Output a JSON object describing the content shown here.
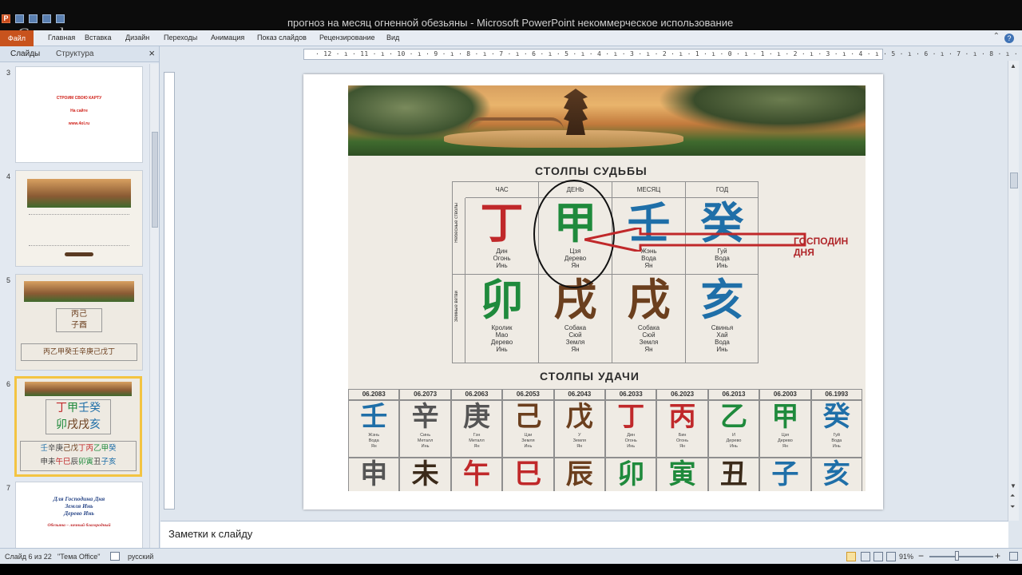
{
  "window": {
    "title": "прогноз на месяц огненной обезьяны - Microsoft PowerPoint некоммерческое использование",
    "watermark": "Google"
  },
  "ribbon": {
    "file": "Файл",
    "tabs": [
      "Главная",
      "Вставка",
      "Дизайн",
      "Переходы",
      "Анимация",
      "Показ слайдов",
      "Рецензирование",
      "Вид"
    ]
  },
  "left_panel": {
    "tab_slides": "Слайды",
    "tab_outline": "Структура",
    "close": "×",
    "slides": [
      {
        "num": "3",
        "lines": [
          "СТРОИМ СВОЮ КАРТУ",
          "На сайте",
          "www.4ol.ru"
        ]
      },
      {
        "num": "4"
      },
      {
        "num": "5"
      },
      {
        "num": "6"
      },
      {
        "num": "7",
        "lines": [
          "Для Господина Дня",
          "Земля Инь",
          "Дерево Инь",
          "Обезьяна – личный благородный"
        ]
      }
    ]
  },
  "ruler": {
    "labels": "· 12 · ı · 11 · ı · 10 · ı · 9 · ı · 8 · ı · 7 · ı · 6 · ı · 5 · ı · 4 · ı · 3 · ı · 2 · ı · 1 · ı · 0 · ı · 1 · ı · 2 · ı · 3 · ı · 4 · ı · 5 · ı · 6 · ı · 7 · ı · 8 · ı · 9 · ı · 10 · ı · 11 · ı · 12 ·"
  },
  "slide": {
    "fate_title": "СТОЛПЫ СУДЬБЫ",
    "side_top": "Небесные стволы",
    "side_bottom": "Земные ветви",
    "columns": [
      "ЧАС",
      "ДЕНЬ",
      "МЕСЯЦ",
      "ГОД"
    ],
    "stems": [
      {
        "glyph": "丁",
        "color": "#c0282a",
        "lines": [
          "Дин",
          "Огонь",
          "Инь"
        ]
      },
      {
        "glyph": "甲",
        "color": "#1f8a3c",
        "lines": [
          "Цзя",
          "Дерево",
          "Ян"
        ]
      },
      {
        "glyph": "壬",
        "color": "#1f6fa8",
        "lines": [
          "Жэнь",
          "Вода",
          "Ян"
        ]
      },
      {
        "glyph": "癸",
        "color": "#1f6fa8",
        "lines": [
          "Гуй",
          "Вода",
          "Инь"
        ]
      }
    ],
    "branches": [
      {
        "glyph": "卯",
        "color": "#1f8a3c",
        "lines": [
          "Кролик",
          "Мао",
          "Дерево",
          "Инь"
        ]
      },
      {
        "glyph": "戌",
        "color": "#6b3f1e",
        "lines": [
          "Собака",
          "Сюй",
          "Земля",
          "Ян"
        ]
      },
      {
        "glyph": "戌",
        "color": "#6b3f1e",
        "lines": [
          "Собака",
          "Сюй",
          "Земля",
          "Ян"
        ]
      },
      {
        "glyph": "亥",
        "color": "#1f6fa8",
        "lines": [
          "Свинья",
          "Хай",
          "Вода",
          "Инь"
        ]
      }
    ],
    "lord_label": [
      "ГОСПОДИН",
      "ДНЯ"
    ],
    "luck_title": "СТОЛПЫ УДАЧИ",
    "luck": [
      {
        "date": "06.2083",
        "stem": "壬",
        "stem_color": "#1f6fa8",
        "lines": [
          "Жэнь",
          "Вода",
          "Ян"
        ],
        "branch": "申",
        "branch_color": "#555555"
      },
      {
        "date": "06.2073",
        "stem": "辛",
        "stem_color": "#555555",
        "lines": [
          "Синь",
          "Металл",
          "Инь"
        ],
        "branch": "未",
        "branch_color": "#3b2a1a"
      },
      {
        "date": "06.2063",
        "stem": "庚",
        "stem_color": "#555555",
        "lines": [
          "Гэн",
          "Металл",
          "Ян"
        ],
        "branch": "午",
        "branch_color": "#c0282a"
      },
      {
        "date": "06.2053",
        "stem": "己",
        "stem_color": "#6b3f1e",
        "lines": [
          "Цзи",
          "Земля",
          "Инь"
        ],
        "branch": "巳",
        "branch_color": "#c0282a"
      },
      {
        "date": "06.2043",
        "stem": "戊",
        "stem_color": "#6b3f1e",
        "lines": [
          "У",
          "Земля",
          "Ян"
        ],
        "branch": "辰",
        "branch_color": "#6b3f1e"
      },
      {
        "date": "06.2033",
        "stem": "丁",
        "stem_color": "#c0282a",
        "lines": [
          "Дин",
          "Огонь",
          "Инь"
        ],
        "branch": "卯",
        "branch_color": "#1f8a3c"
      },
      {
        "date": "06.2023",
        "stem": "丙",
        "stem_color": "#c0282a",
        "lines": [
          "Бин",
          "Огонь",
          "Ян"
        ],
        "branch": "寅",
        "branch_color": "#1f8a3c"
      },
      {
        "date": "06.2013",
        "stem": "乙",
        "stem_color": "#1f8a3c",
        "lines": [
          "И",
          "Дерево",
          "Инь"
        ],
        "branch": "丑",
        "branch_color": "#3b2a1a"
      },
      {
        "date": "06.2003",
        "stem": "甲",
        "stem_color": "#1f8a3c",
        "lines": [
          "Цзя",
          "Дерево",
          "Ян"
        ],
        "branch": "子",
        "branch_color": "#1f6fa8"
      },
      {
        "date": "06.1993",
        "stem": "癸",
        "stem_color": "#1f6fa8",
        "lines": [
          "Гуй",
          "Вода",
          "Инь"
        ],
        "branch": "亥",
        "branch_color": "#1f6fa8"
      }
    ]
  },
  "notes": {
    "placeholder": "Заметки к слайду"
  },
  "status": {
    "slide": "Слайд 6 из 22",
    "theme": "\"Тема Office\"",
    "language": "русский",
    "zoom": "91%",
    "zoom_minus": "−",
    "zoom_plus": "+"
  }
}
